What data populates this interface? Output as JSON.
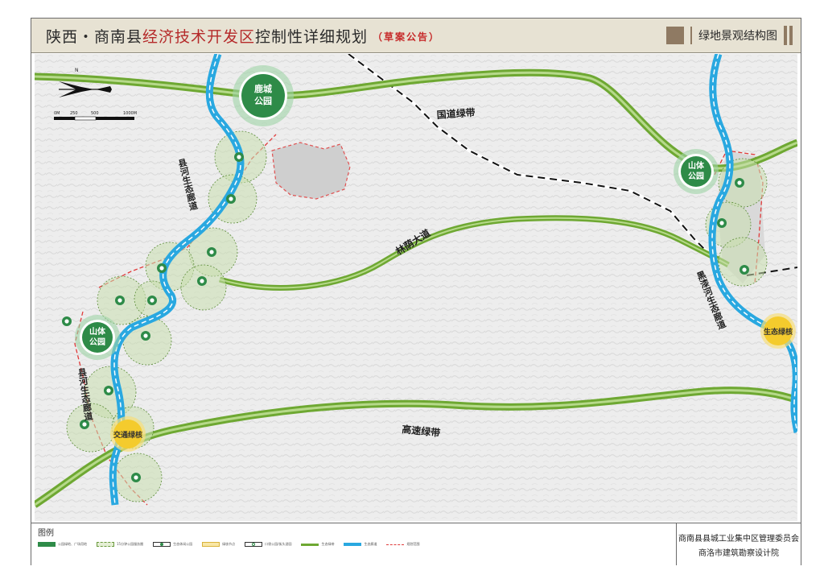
{
  "header": {
    "title_prefix": "陕西・商南县",
    "title_highlight": "经济技术开发区",
    "title_suffix": "控制性详细规划",
    "title_note": "（草案公告）",
    "map_name": "绿地景观结构图"
  },
  "map": {
    "north_label": "N",
    "scale_labels": [
      "0M",
      "250",
      "500",
      "1000M"
    ],
    "parks": [
      {
        "label_line1": "鹿城",
        "label_line2": "公园"
      },
      {
        "label_line1": "山体",
        "label_line2": "公园"
      },
      {
        "label_line1": "山体",
        "label_line2": "公园"
      }
    ],
    "nodes": [
      "生态绿核",
      "交通绿核"
    ],
    "belt_labels": [
      "国道绿带",
      "林荫大道",
      "高速绿带"
    ],
    "corridor_labels": [
      "县河生态廊道",
      "县河生态廊道",
      "黑漆河生态廊道"
    ]
  },
  "legend": {
    "title": "图例",
    "items": [
      {
        "label": "公园绿地、广场用地",
        "swatch": "green-fill"
      },
      {
        "label": "15分钟公园服务圈",
        "swatch": "light-dashed"
      },
      {
        "label": "生态休闲公园",
        "swatch": "circle-dark"
      },
      {
        "label": "绿核节点",
        "swatch": "yellow"
      },
      {
        "label": "口袋公园/街头游园",
        "swatch": "circle-light"
      },
      {
        "label": "生态绿带",
        "swatch": "green-line"
      },
      {
        "label": "生态廊道",
        "swatch": "blue-line"
      },
      {
        "label": "规划范围",
        "swatch": "red-dash"
      }
    ]
  },
  "org": {
    "line1": "商南县县城工业集中区管理委员会",
    "line2": "商洛市建筑勘察设计院"
  },
  "colors": {
    "belt_green": "#6ea832",
    "river_blue": "#29a8e0",
    "park_green": "#2e8b48",
    "node_yellow": "#f4cb2d",
    "boundary_red": "#e03a3a",
    "terrain": "#eeeeee",
    "header_bg": "#e7e2d3"
  }
}
